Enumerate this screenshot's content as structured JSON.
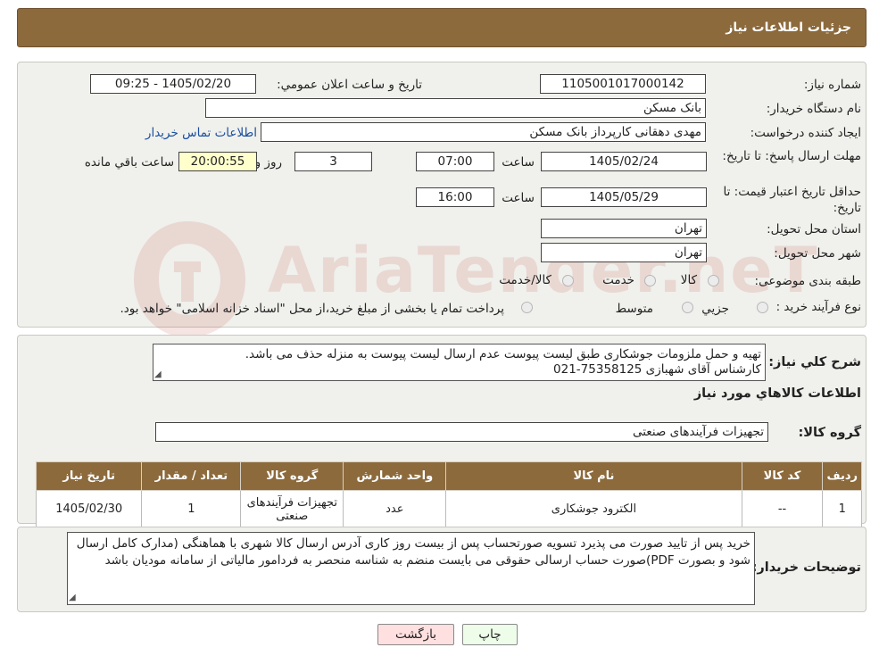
{
  "header": {
    "title": "جزئیات اطلاعات نیاز"
  },
  "form": {
    "need_number_label": "شماره نیاز:",
    "need_number": "1105001017000142",
    "announce_label": "تاریخ و ساعت اعلان عمومي:",
    "announce_value": "1405/02/20 - 09:25",
    "buyer_org_label": "نام دستگاه خريدار:",
    "buyer_org": "بانک مسکن",
    "requester_label": "ايجاد کننده درخواست:",
    "requester": "مهدی دهقانی کارپرداز بانک مسکن",
    "contact_link": "اطلاعات تماس خريدار",
    "deadline_label": "مهلت ارسال پاسخ: تا تاريخ:",
    "deadline_date": "1405/02/24",
    "time_word": "ساعت",
    "deadline_time": "07:00",
    "days_value": "3",
    "days_word": "روز و",
    "remaining_time": "20:00:55",
    "remaining_label": "ساعت باقي مانده",
    "price_validity_label": "حداقل تاريخ اعتبار قيمت: تا تاريخ:",
    "price_validity_date": "1405/05/29",
    "price_validity_time": "16:00",
    "province_label": "استان محل تحويل:",
    "province": "تهران",
    "city_label": "شهر محل تحويل:",
    "city": "تهران",
    "category_label": "طبقه بندی موضوعی:",
    "category_options": [
      "کالا",
      "خدمت",
      "کالا/خدمت"
    ],
    "process_label": "نوع فرآيند خريد :",
    "process_options": [
      "جزيي",
      "متوسط"
    ],
    "process_note": "پرداخت تمام يا بخشی از مبلغ خريد،از محل \"اسناد خزانه اسلامی\" خواهد بود."
  },
  "description": {
    "label": "شرح کلي نياز:",
    "line1": "تهیه و حمل ملزومات جوشکاری طبق لیست پیوست عدم ارسال لیست پیوست به منزله حذف می باشد.",
    "line2": "کارشناس آقای شهبازی 75358125-021"
  },
  "goods": {
    "section_title": "اطلاعات کالاهاي مورد نياز",
    "group_label": "گروه کالا:",
    "group_value": "تجهیزات فرآیندهای صنعتی"
  },
  "table": {
    "headers": [
      "رديف",
      "کد کالا",
      "نام کالا",
      "واحد شمارش",
      "گروه کالا",
      "تعداد / مقدار",
      "تاريخ نياز"
    ],
    "rows": [
      [
        "1",
        "--",
        "الکترود جوشکاری",
        "عدد",
        "تجهیزات فرآیندهای صنعتی",
        "1",
        "1405/02/30"
      ]
    ]
  },
  "buyer_notes": {
    "label": "توضيحات خريدار:",
    "text": "خرید پس از تایید صورت می پذیرد تسویه صورتحساب پس از بیست روز کاری آدرس ارسال کالا شهری با هماهنگی (مدارک کامل ارسال شود و بصورت PDF)صورت حساب ارسالی حقوقی می بایست منضم به شناسه منحصر به فردامور مالیاتی از سامانه مودیان باشد"
  },
  "buttons": {
    "print": "چاپ",
    "back": "بازگشت"
  },
  "watermark": {
    "text": "AriaTender.neT"
  },
  "colors": {
    "header_bg": "#8c6a3c",
    "panel_bg": "#f0f0ec",
    "link": "#1a4fa0",
    "back_btn": "#ffe0e0",
    "print_btn": "#eefdea"
  }
}
